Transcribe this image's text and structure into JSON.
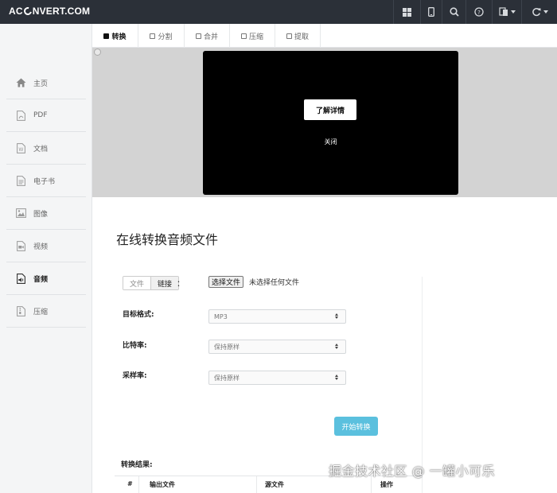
{
  "app": {
    "logo_left": "AC",
    "logo_right": "NVERT.COM"
  },
  "topbar": {
    "buttons": [
      {
        "name": "grid-icon"
      },
      {
        "name": "mobile-icon"
      },
      {
        "name": "search-icon"
      },
      {
        "name": "help-icon"
      },
      {
        "name": "language-icon"
      },
      {
        "name": "refresh-icon"
      }
    ]
  },
  "sidebar": {
    "items": [
      {
        "label": "主页",
        "icon": "home-icon"
      },
      {
        "label": "PDF",
        "icon": "pdf-icon"
      },
      {
        "label": "文档",
        "icon": "document-icon"
      },
      {
        "label": "电子书",
        "icon": "ebook-icon"
      },
      {
        "label": "图像",
        "icon": "image-icon"
      },
      {
        "label": "视频",
        "icon": "video-icon"
      },
      {
        "label": "音频",
        "icon": "audio-icon",
        "active": true
      },
      {
        "label": "压缩",
        "icon": "archive-icon"
      }
    ]
  },
  "tabs": [
    {
      "label": "转换",
      "active": true
    },
    {
      "label": "分割"
    },
    {
      "label": "合并"
    },
    {
      "label": "压缩"
    },
    {
      "label": "提取"
    }
  ],
  "ad": {
    "button_label": "了解详情",
    "close_label": "关闭"
  },
  "main": {
    "title": "在线转换音频文件",
    "source_toggle": [
      "文件",
      "链接"
    ],
    "source_colon": "：",
    "file_button": "选择文件",
    "no_file_text": "未选择任何文件",
    "fields": [
      {
        "label": "目标格式:",
        "value": "MP3"
      },
      {
        "label": "比特率:",
        "value": "保持原样"
      },
      {
        "label": "采样率:",
        "value": "保持原样"
      }
    ],
    "start_button": "开始转换",
    "result_title": "转换结果:",
    "table_headers": [
      "#",
      "输出文件",
      "源文件",
      "操作"
    ]
  },
  "colors": {
    "topbar": "#2b3038",
    "accent": "#5bc0de",
    "sidebar_bg": "#f4f5f6",
    "ad_bg": "#d3d3d3"
  },
  "watermark": "掘金技术社区 @ 一罐小可乐"
}
